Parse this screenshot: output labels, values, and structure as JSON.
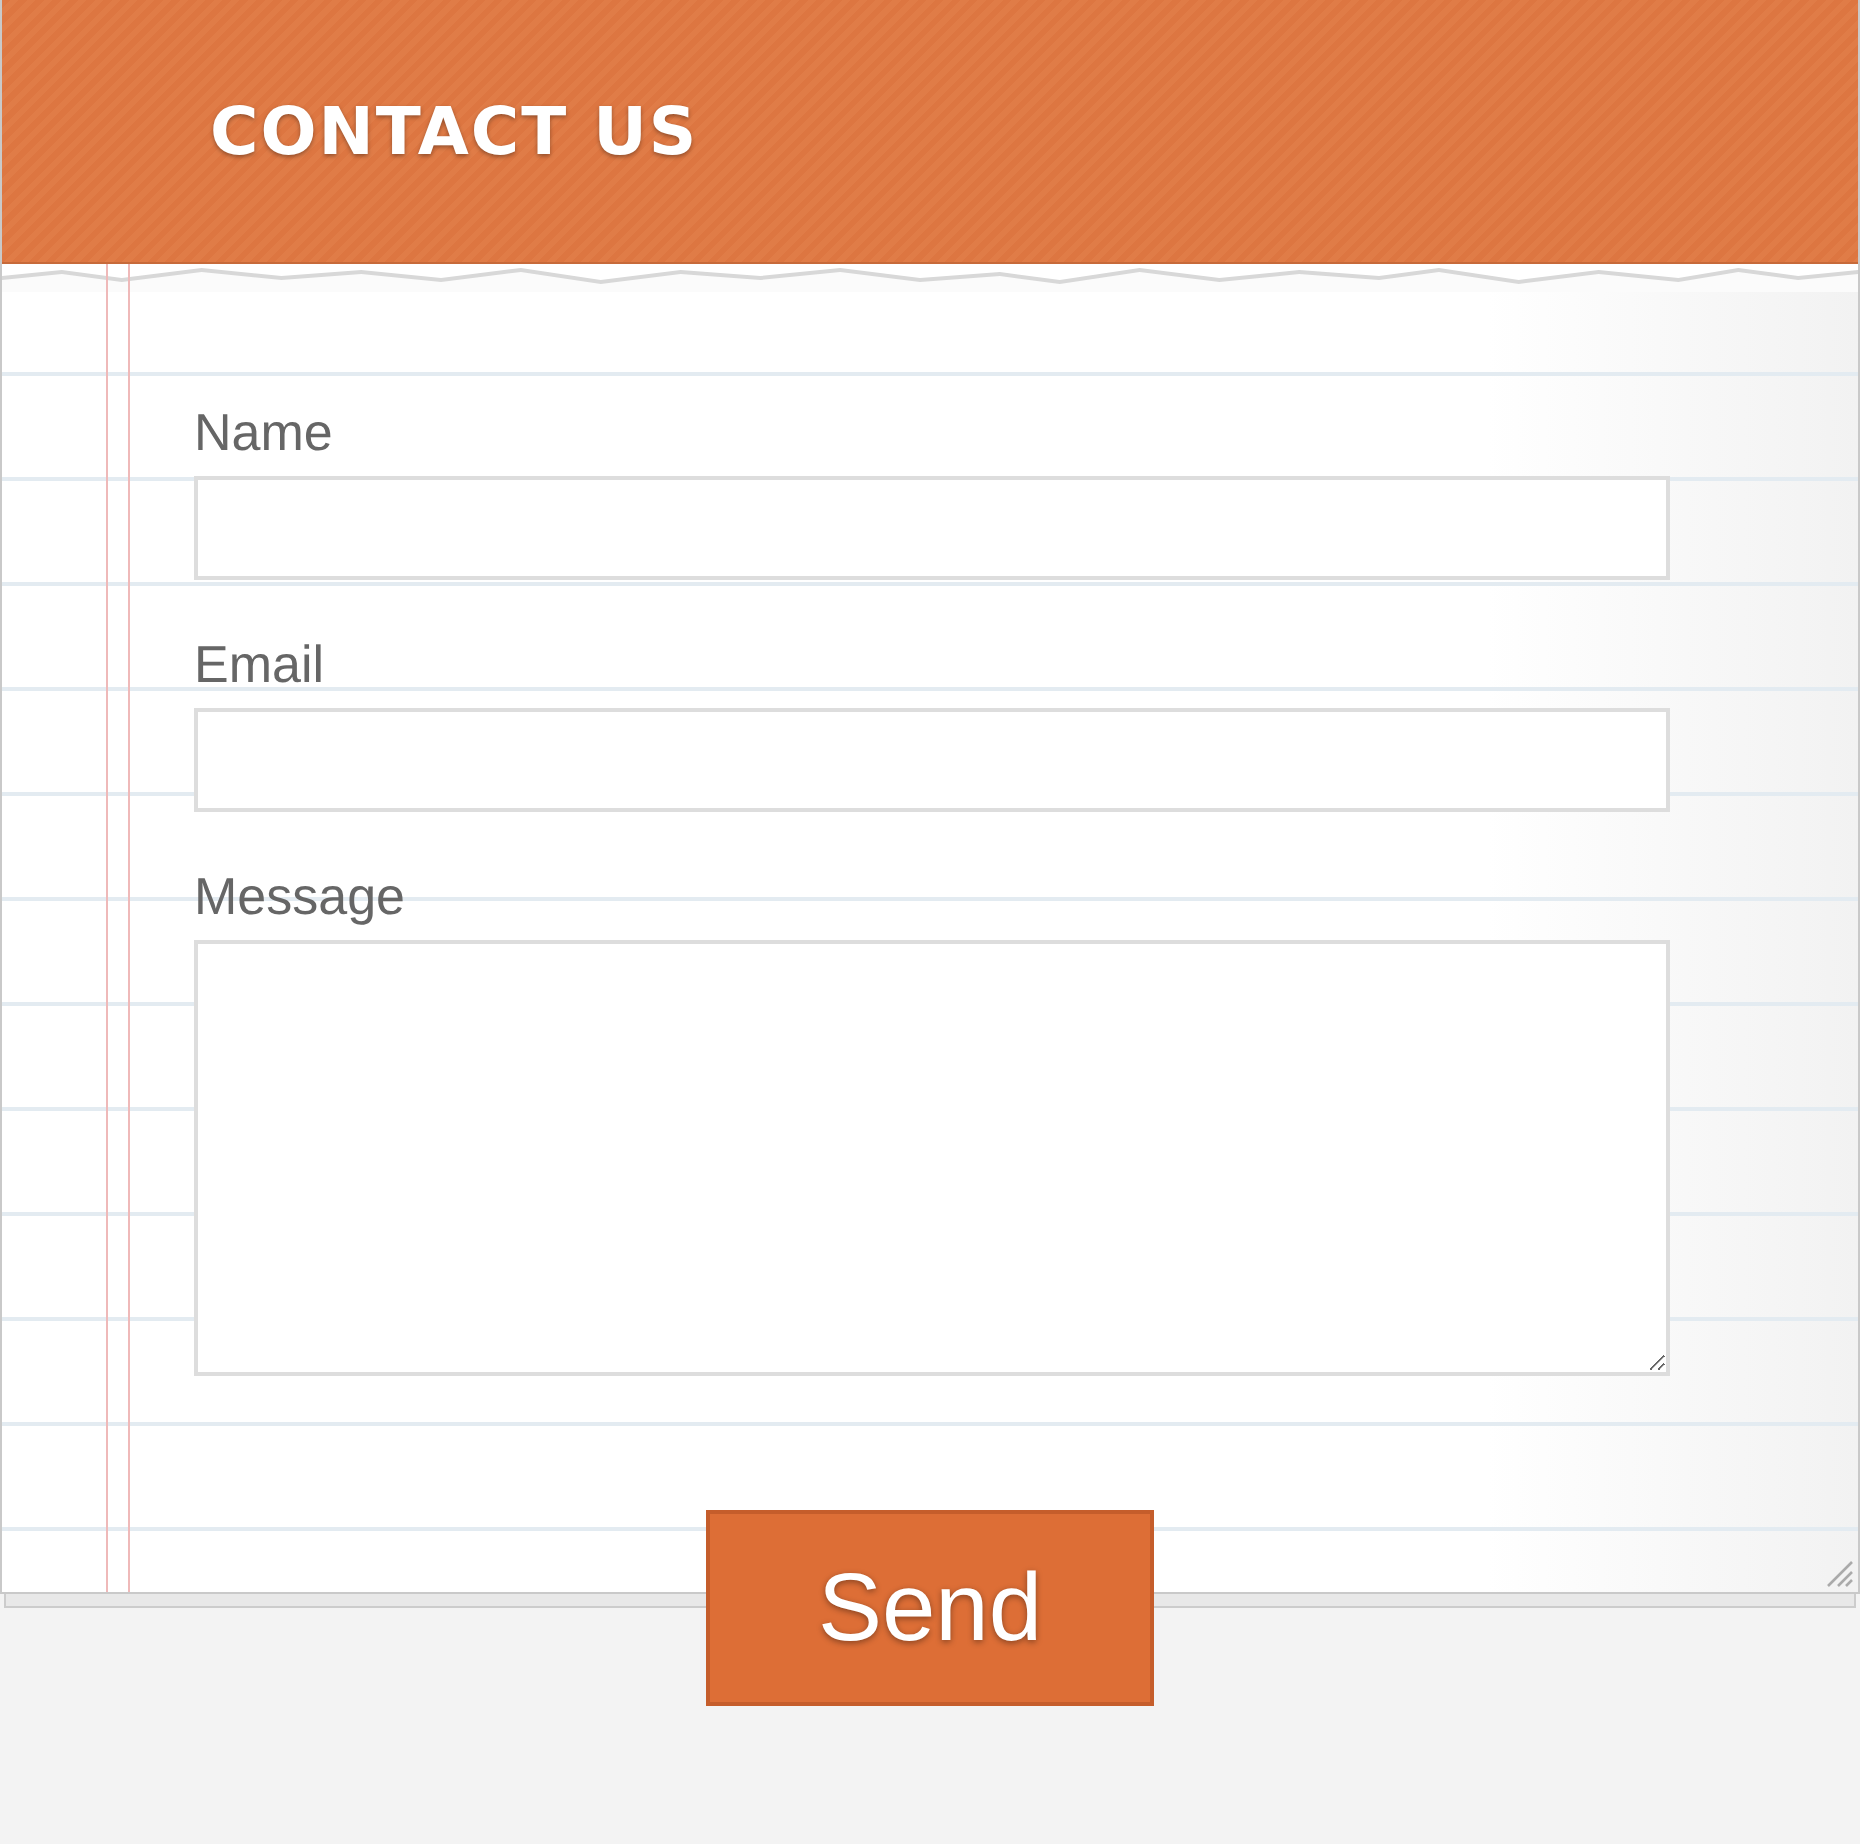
{
  "header": {
    "title": "CONTACT US"
  },
  "fields": [
    {
      "label": "Name",
      "kind": "input"
    },
    {
      "label": "Email",
      "kind": "input"
    },
    {
      "label": "Message",
      "kind": "textarea"
    }
  ],
  "submit": {
    "label": "Send"
  }
}
